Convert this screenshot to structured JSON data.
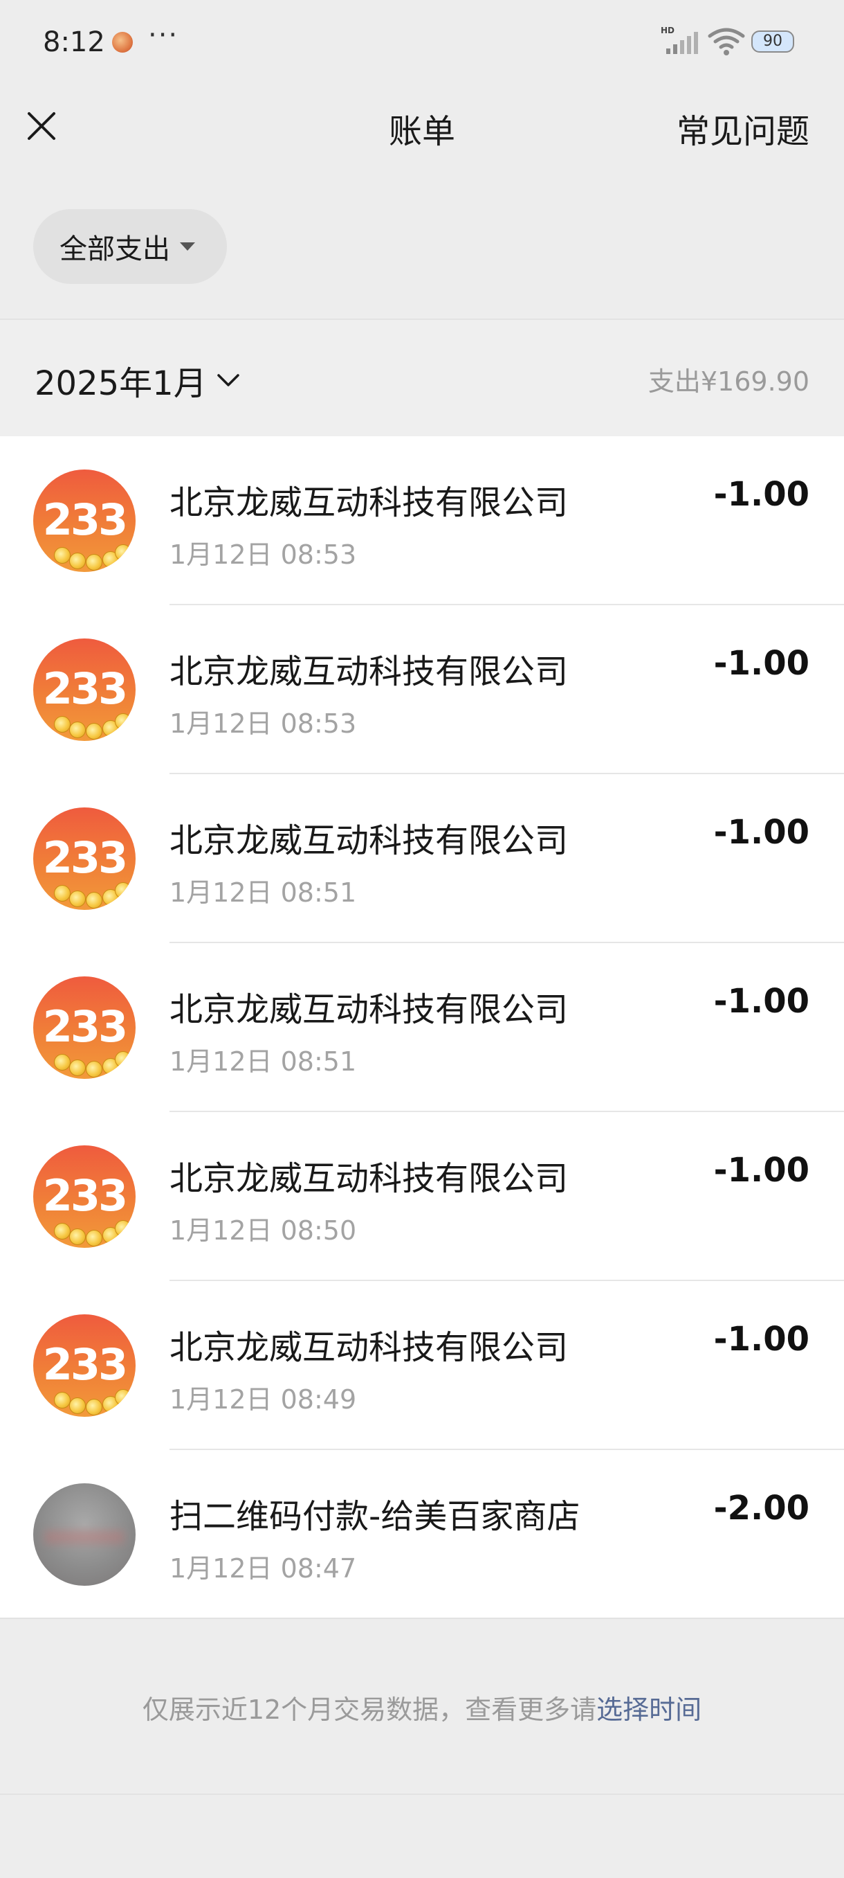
{
  "status_bar": {
    "time": "8:12",
    "more": "···",
    "network_badge": "HD",
    "battery": "90",
    "icons": [
      "notification-app-icon",
      "signal-icon",
      "wifi-icon",
      "battery-icon"
    ]
  },
  "navbar": {
    "title": "账单",
    "faq_label": "常见问题",
    "close_icon": "close-icon"
  },
  "filter": {
    "label": "全部支出",
    "icon": "caret-down-icon"
  },
  "month_header": {
    "month": "2025年1月",
    "total": "支出¥169.90",
    "icon": "chevron-down-icon"
  },
  "transactions": [
    {
      "name": "北京龙威互动科技有限公司",
      "time": "1月12日 08:53",
      "amount": "-1.00",
      "avatar": "233"
    },
    {
      "name": "北京龙威互动科技有限公司",
      "time": "1月12日 08:53",
      "amount": "-1.00",
      "avatar": "233"
    },
    {
      "name": "北京龙威互动科技有限公司",
      "time": "1月12日 08:51",
      "amount": "-1.00",
      "avatar": "233"
    },
    {
      "name": "北京龙威互动科技有限公司",
      "time": "1月12日 08:51",
      "amount": "-1.00",
      "avatar": "233"
    },
    {
      "name": "北京龙威互动科技有限公司",
      "time": "1月12日 08:50",
      "amount": "-1.00",
      "avatar": "233"
    },
    {
      "name": "北京龙威互动科技有限公司",
      "time": "1月12日 08:49",
      "amount": "-1.00",
      "avatar": "233"
    },
    {
      "name": "扫二维码付款-给美百家商店",
      "time": "1月12日 08:47",
      "amount": "-2.00",
      "avatar": "blurred"
    }
  ],
  "footer": {
    "note": "仅展示近12个月交易数据，查看更多请",
    "link": "选择时间"
  },
  "colors": {
    "background": "#ededed",
    "list_background": "#ffffff",
    "link": "#576b95",
    "secondary_text": "#a3a3a3",
    "avatar_orange": "#f07f38"
  }
}
